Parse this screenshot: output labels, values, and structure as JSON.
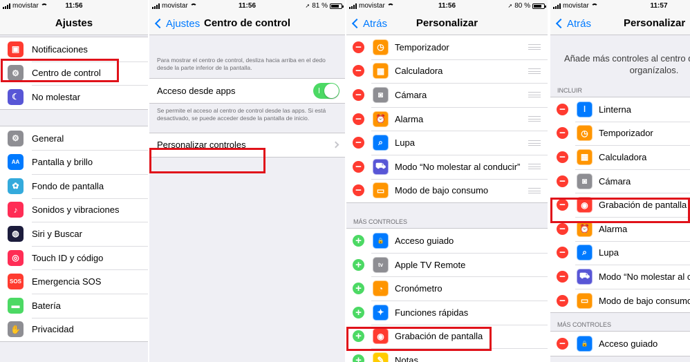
{
  "colors": {
    "accent": "#007aff",
    "minus": "#ff3b30",
    "plus": "#4cd964",
    "highlight": "#e0121a"
  },
  "panel1": {
    "status": {
      "carrier": "movistar",
      "time": "11:56"
    },
    "nav": {
      "title": "Ajustes"
    },
    "group1": [
      {
        "label": "Notificaciones",
        "icon": "notifications-icon",
        "color": "#ff3b30"
      },
      {
        "label": "Centro de control",
        "icon": "control-center-icon",
        "color": "#8e8e93"
      },
      {
        "label": "No molestar",
        "icon": "moon-icon",
        "color": "#5856d6"
      }
    ],
    "group2": [
      {
        "label": "General",
        "icon": "gear-icon",
        "color": "#8e8e93"
      },
      {
        "label": "Pantalla y brillo",
        "icon": "display-icon",
        "color": "#007aff"
      },
      {
        "label": "Fondo de pantalla",
        "icon": "wallpaper-icon",
        "color": "#34aadc"
      },
      {
        "label": "Sonidos y vibraciones",
        "icon": "sound-icon",
        "color": "#ff2d55"
      },
      {
        "label": "Siri y Buscar",
        "icon": "siri-icon",
        "color": "#1c1c3c"
      },
      {
        "label": "Touch ID y código",
        "icon": "fingerprint-icon",
        "color": "#ff2d55"
      },
      {
        "label": "Emergencia SOS",
        "icon": "sos-icon",
        "color": "#ff3b30"
      },
      {
        "label": "Batería",
        "icon": "battery-icon",
        "color": "#4cd964"
      },
      {
        "label": "Privacidad",
        "icon": "hand-icon",
        "color": "#8e8e93"
      }
    ]
  },
  "panel2": {
    "status": {
      "carrier": "movistar",
      "time": "11:56",
      "battery": "81 %"
    },
    "nav": {
      "back": "Ajustes",
      "title": "Centro de control"
    },
    "intro_note": "Para mostrar el centro de control, desliza hacia arriba en el dedo desde la parte inferior de la pantalla.",
    "access_label": "Acceso desde apps",
    "access_note": "Se permite el acceso al centro de control desde las apps. Si está desactivado, se puede acceder desde la pantalla de inicio.",
    "customize_label": "Personalizar controles"
  },
  "panel3": {
    "status": {
      "carrier": "movistar",
      "time": "11:56",
      "battery": "80 %"
    },
    "nav": {
      "back": "Atrás",
      "title": "Personalizar"
    },
    "included": [
      {
        "label": "Temporizador",
        "icon": "timer-icon",
        "color": "#ff9500",
        "glyph": "◷"
      },
      {
        "label": "Calculadora",
        "icon": "calculator-icon",
        "color": "#ff9500",
        "glyph": "▦"
      },
      {
        "label": "Cámara",
        "icon": "camera-icon",
        "color": "#8e8e93",
        "glyph": "◙"
      },
      {
        "label": "Alarma",
        "icon": "alarm-icon",
        "color": "#ff9500",
        "glyph": "⏰"
      },
      {
        "label": "Lupa",
        "icon": "magnifier-icon",
        "color": "#007aff",
        "glyph": "⌕"
      },
      {
        "label": "Modo “No molestar al conducir”",
        "icon": "car-icon",
        "color": "#5856d6",
        "glyph": "⛟"
      },
      {
        "label": "Modo de bajo consumo",
        "icon": "low-power-icon",
        "color": "#ff9500",
        "glyph": "▭"
      }
    ],
    "more_header": "MÁS CONTROLES",
    "more": [
      {
        "label": "Acceso guiado",
        "icon": "lock-icon",
        "color": "#007aff",
        "glyph": "🔒"
      },
      {
        "label": "Apple TV Remote",
        "icon": "apple-tv-icon",
        "color": "#8e8e93",
        "glyph": "tv"
      },
      {
        "label": "Cronómetro",
        "icon": "stopwatch-icon",
        "color": "#ff9500",
        "glyph": "◔"
      },
      {
        "label": "Funciones rápidas",
        "icon": "accessibility-icon",
        "color": "#007aff",
        "glyph": "✦"
      },
      {
        "label": "Grabación de pantalla",
        "icon": "record-icon",
        "color": "#ff3b30",
        "glyph": "◉"
      },
      {
        "label": "Notas",
        "icon": "notes-icon",
        "color": "#ffcc00",
        "glyph": "✎"
      }
    ]
  },
  "panel4": {
    "status": {
      "carrier": "movistar",
      "time": "11:57"
    },
    "nav": {
      "back": "Atrás",
      "title": "Personalizar"
    },
    "intro_line1": "Añade más controles al centro de",
    "intro_line2": "organízalos.",
    "include_header": "INCLUIR",
    "included": [
      {
        "label": "Linterna",
        "icon": "flashlight-icon",
        "color": "#007aff",
        "glyph": "ǀ"
      },
      {
        "label": "Temporizador",
        "icon": "timer-icon",
        "color": "#ff9500",
        "glyph": "◷"
      },
      {
        "label": "Calculadora",
        "icon": "calculator-icon",
        "color": "#ff9500",
        "glyph": "▦"
      },
      {
        "label": "Cámara",
        "icon": "camera-icon",
        "color": "#8e8e93",
        "glyph": "◙"
      },
      {
        "label": "Grabación de pantalla",
        "icon": "record-icon",
        "color": "#ff3b30",
        "glyph": "◉"
      },
      {
        "label": "Alarma",
        "icon": "alarm-icon",
        "color": "#ff9500",
        "glyph": "⏰"
      },
      {
        "label": "Lupa",
        "icon": "magnifier-icon",
        "color": "#007aff",
        "glyph": "⌕"
      },
      {
        "label": "Modo “No molestar al c",
        "icon": "car-icon",
        "color": "#5856d6",
        "glyph": "⛟"
      },
      {
        "label": "Modo de bajo consumo",
        "icon": "low-power-icon",
        "color": "#ff9500",
        "glyph": "▭"
      }
    ],
    "more_header": "MÁS CONTROLES",
    "more": [
      {
        "label": "Acceso guiado",
        "icon": "lock-icon",
        "color": "#007aff",
        "glyph": "🔒"
      }
    ]
  }
}
